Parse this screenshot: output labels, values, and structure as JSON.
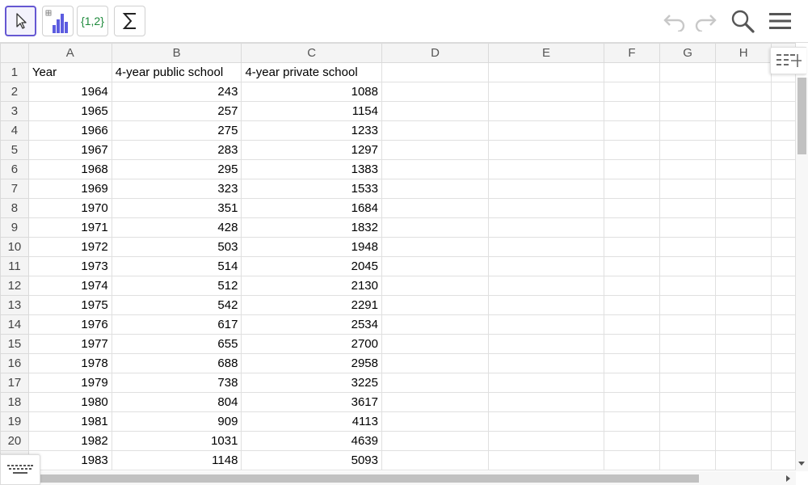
{
  "toolbar": {
    "tools": [
      {
        "icon": "move-cursor-icon",
        "active": true
      },
      {
        "icon": "bar-chart-icon",
        "active": false
      },
      {
        "icon": "list-icon",
        "label": "{1,2}",
        "active": false
      },
      {
        "icon": "sum-icon",
        "active": false
      }
    ],
    "right_icons": [
      "undo-icon",
      "redo-icon",
      "search-icon",
      "menu-icon"
    ]
  },
  "sheet": {
    "columns": [
      "A",
      "B",
      "C",
      "D",
      "E",
      "F",
      "G",
      "H"
    ],
    "rows": [
      {
        "n": "1",
        "cells": [
          "Year",
          "4-year public school",
          "4-year private school"
        ]
      },
      {
        "n": "2",
        "cells": [
          "1964",
          "243",
          "1088"
        ]
      },
      {
        "n": "3",
        "cells": [
          "1965",
          "257",
          "1154"
        ]
      },
      {
        "n": "4",
        "cells": [
          "1966",
          "275",
          "1233"
        ]
      },
      {
        "n": "5",
        "cells": [
          "1967",
          "283",
          "1297"
        ]
      },
      {
        "n": "6",
        "cells": [
          "1968",
          "295",
          "1383"
        ]
      },
      {
        "n": "7",
        "cells": [
          "1969",
          "323",
          "1533"
        ]
      },
      {
        "n": "8",
        "cells": [
          "1970",
          "351",
          "1684"
        ]
      },
      {
        "n": "9",
        "cells": [
          "1971",
          "428",
          "1832"
        ]
      },
      {
        "n": "10",
        "cells": [
          "1972",
          "503",
          "1948"
        ]
      },
      {
        "n": "11",
        "cells": [
          "1973",
          "514",
          "2045"
        ]
      },
      {
        "n": "12",
        "cells": [
          "1974",
          "512",
          "2130"
        ]
      },
      {
        "n": "13",
        "cells": [
          "1975",
          "542",
          "2291"
        ]
      },
      {
        "n": "14",
        "cells": [
          "1976",
          "617",
          "2534"
        ]
      },
      {
        "n": "15",
        "cells": [
          "1977",
          "655",
          "2700"
        ]
      },
      {
        "n": "16",
        "cells": [
          "1978",
          "688",
          "2958"
        ]
      },
      {
        "n": "17",
        "cells": [
          "1979",
          "738",
          "3225"
        ]
      },
      {
        "n": "18",
        "cells": [
          "1980",
          "804",
          "3617"
        ]
      },
      {
        "n": "19",
        "cells": [
          "1981",
          "909",
          "4113"
        ]
      },
      {
        "n": "20",
        "cells": [
          "1982",
          "1031",
          "4639"
        ]
      },
      {
        "n": "",
        "cells": [
          "1983",
          "1148",
          "5093"
        ]
      }
    ]
  },
  "colors": {
    "accent": "#6557d2",
    "header_bg": "#f4f4f4",
    "grid_line": "#e0e0e0",
    "list_tool_text": "#1e8a3c",
    "chart_tool_bars": "#5c5ce0"
  },
  "footer": {
    "keyboard_icon": "keyboard-icon"
  }
}
